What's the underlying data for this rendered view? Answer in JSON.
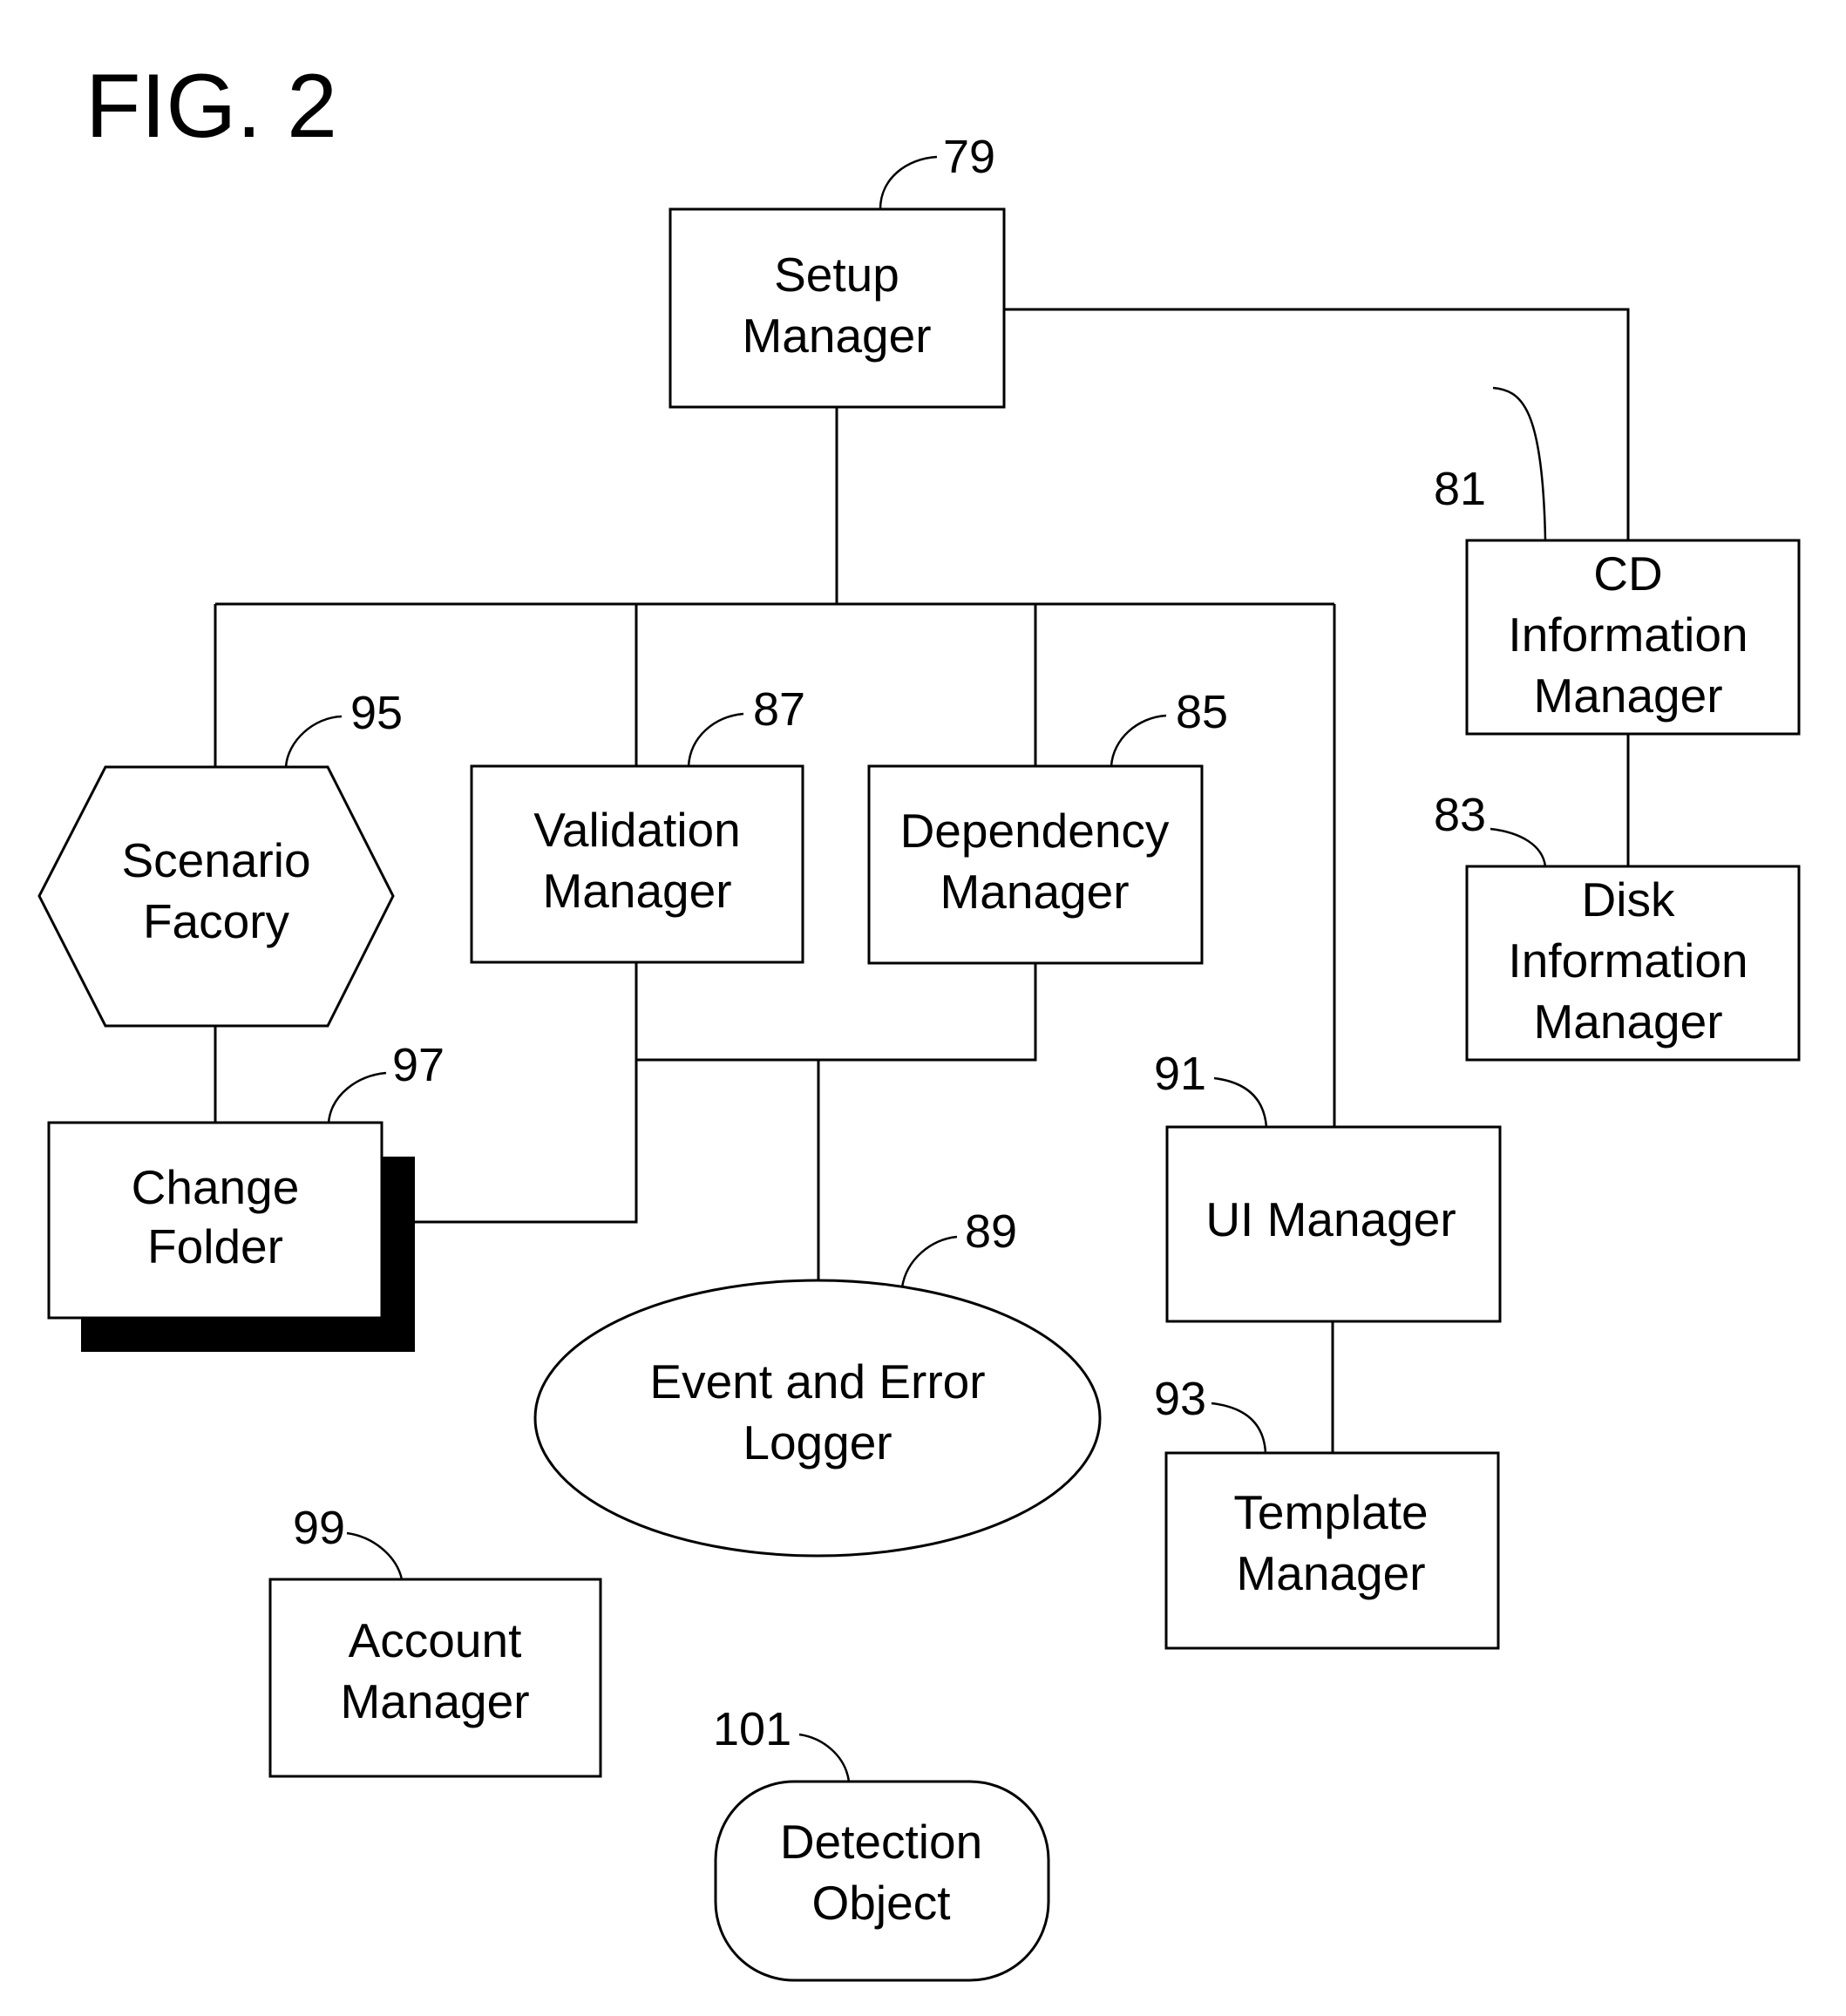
{
  "figure": {
    "title": "FIG. 2"
  },
  "nodes": {
    "setup_manager": {
      "ref": "79",
      "lines": [
        "Setup",
        "Manager"
      ],
      "shape": "rectangle"
    },
    "cd_information_manager": {
      "ref": "81",
      "lines": [
        "CD",
        "Information",
        "Manager"
      ],
      "shape": "rectangle"
    },
    "disk_information_manager": {
      "ref": "83",
      "lines": [
        "Disk",
        "Information",
        "Manager"
      ],
      "shape": "rectangle"
    },
    "scenario_factory": {
      "ref": "95",
      "lines": [
        "Scenario",
        "Facory"
      ],
      "shape": "hexagon"
    },
    "validation_manager": {
      "ref": "87",
      "lines": [
        "Validation",
        "Manager"
      ],
      "shape": "rectangle"
    },
    "dependency_manager": {
      "ref": "85",
      "lines": [
        "Dependency",
        "Manager"
      ],
      "shape": "rectangle"
    },
    "change_folder": {
      "ref": "97",
      "lines": [
        "Change",
        "Folder"
      ],
      "shape": "shadowed-rectangle"
    },
    "event_error_logger": {
      "ref": "89",
      "lines": [
        "Event and Error",
        "Logger"
      ],
      "shape": "ellipse"
    },
    "ui_manager": {
      "ref": "91",
      "lines": [
        "UI Manager"
      ],
      "shape": "rectangle"
    },
    "template_manager": {
      "ref": "93",
      "lines": [
        "Template",
        "Manager"
      ],
      "shape": "rectangle"
    },
    "account_manager": {
      "ref": "99",
      "lines": [
        "Account",
        "Manager"
      ],
      "shape": "rectangle"
    },
    "detection_object": {
      "ref": "101",
      "lines": [
        "Detection",
        "Object"
      ],
      "shape": "rounded-rectangle"
    }
  },
  "connections": [
    [
      "setup_manager",
      "cd_information_manager"
    ],
    [
      "cd_information_manager",
      "disk_information_manager"
    ],
    [
      "setup_manager",
      "scenario_factory"
    ],
    [
      "setup_manager",
      "validation_manager"
    ],
    [
      "setup_manager",
      "dependency_manager"
    ],
    [
      "setup_manager",
      "ui_manager"
    ],
    [
      "scenario_factory",
      "change_folder"
    ],
    [
      "validation_manager",
      "change_folder"
    ],
    [
      "validation_manager",
      "event_error_logger"
    ],
    [
      "dependency_manager",
      "event_error_logger"
    ],
    [
      "ui_manager",
      "template_manager"
    ]
  ]
}
